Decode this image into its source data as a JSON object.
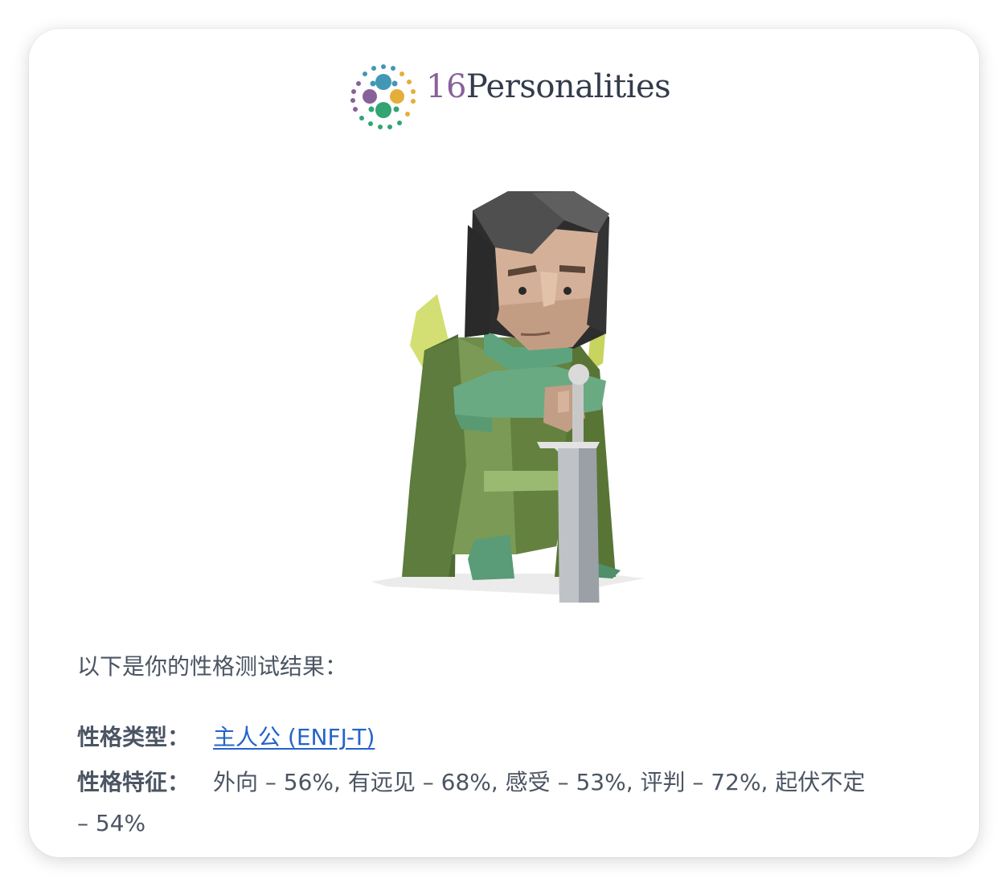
{
  "logo": {
    "number": "16",
    "wordmark": "Personalities",
    "dot_colors": [
      "#88619a",
      "#4298b4",
      "#e4ae3a",
      "#33a474"
    ]
  },
  "illustration": {
    "name": "ENFJ protagonist avatar"
  },
  "result": {
    "intro": "以下是你的性格测试结果：",
    "type_label": "性格类型：",
    "type_value": "主人公 (ENFJ-T)",
    "traits_label": "性格特征：",
    "traits_value_line1": "外向 – 56%, 有远见 – 68%, 感受 – 53%, 评判 – 72%, 起伏不定",
    "traits_value_line2": "– 54%"
  },
  "colors": {
    "link": "#2563c9",
    "text": "#4b5563"
  }
}
